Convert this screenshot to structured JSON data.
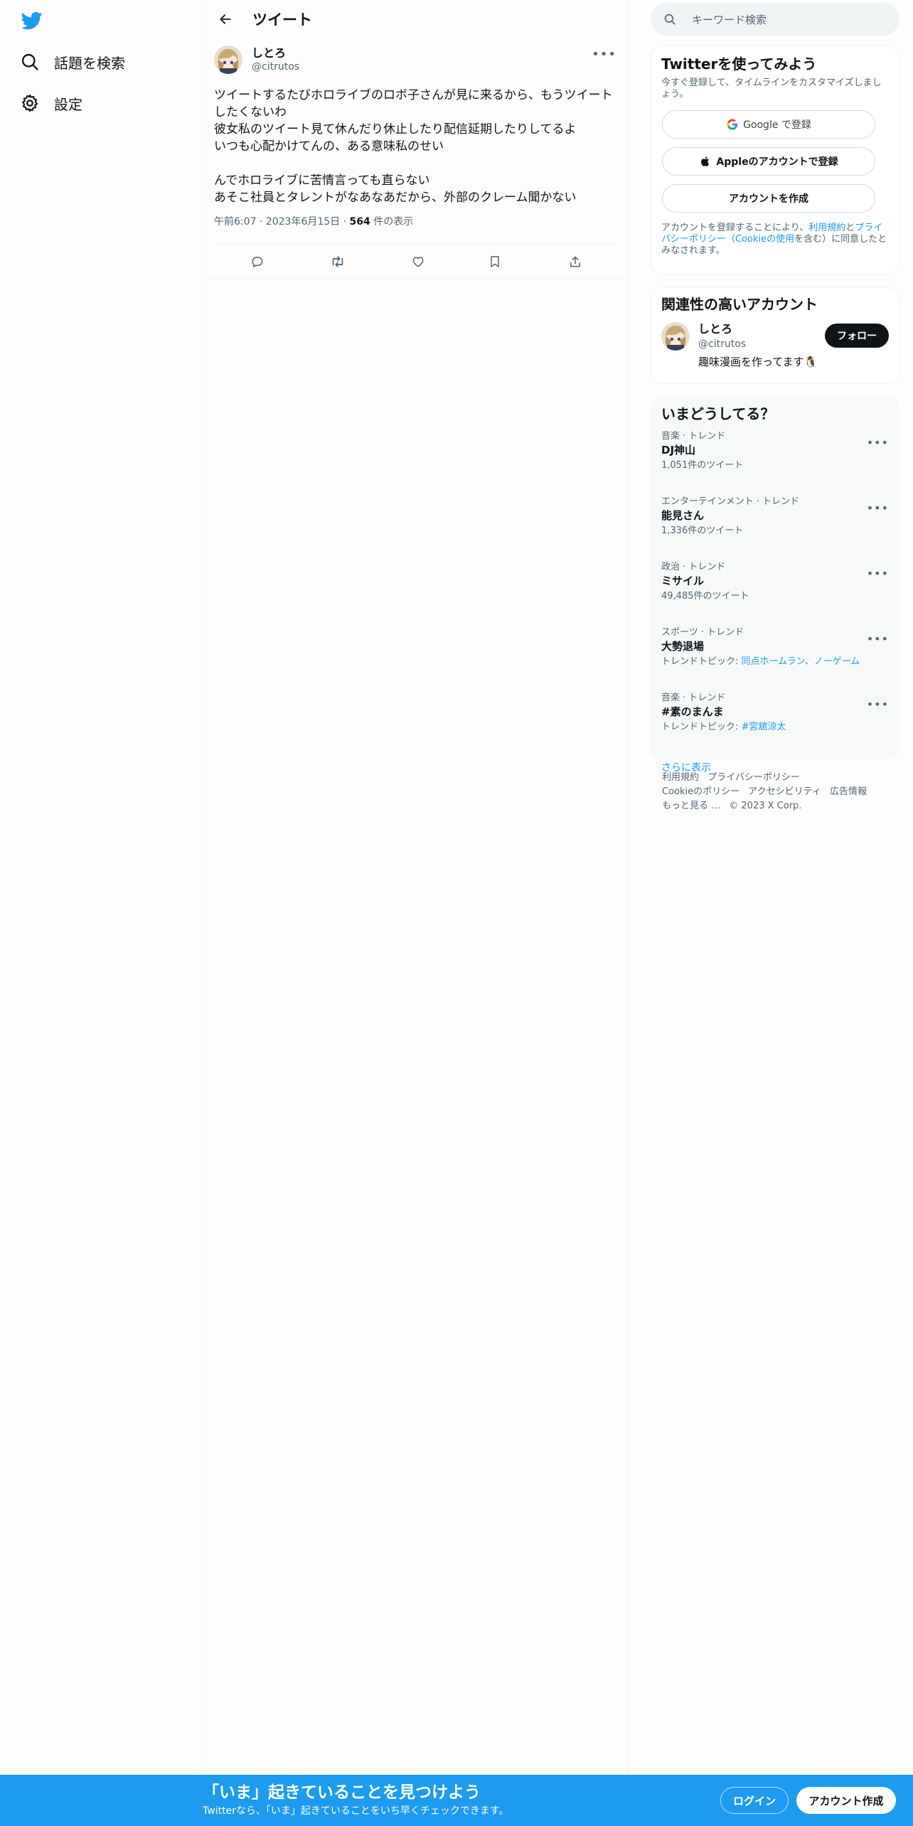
{
  "nav": {
    "logo_icon": "twitter-bird-icon",
    "items": [
      {
        "label": "話題を検索",
        "icon": "search-icon"
      },
      {
        "label": "設定",
        "icon": "gear-icon"
      }
    ]
  },
  "main": {
    "title": "ツイート",
    "tweet": {
      "author_name": "しとろ",
      "author_handle": "@citrutos",
      "text": "ツイートするたびホロライブのロボ子さんが見に来るから、もうツイートしたくないわ\n彼女私のツイート見て休んだり休止したり配信延期したりしてるよ\nいつも心配かけてんの、ある意味私のせい\n\nんでホロライブに苦情言っても直らない\nあそこ社員とタレントがなあなあだから、外部のクレーム聞かない",
      "time": "午前6:07",
      "date": "2023年6月15日",
      "views_count": "564",
      "views_label": "件の表示",
      "sep": "·"
    }
  },
  "right": {
    "search_placeholder": "キーワード検索",
    "signup": {
      "title": "Twitterを使ってみよう",
      "subtitle": "今すぐ登録して、タイムラインをカスタマイズしましょう。",
      "google_label": "Google で登録",
      "apple_label": "Appleのアカウントで登録",
      "create_label": "アカウントを作成",
      "legal_pre": "アカウントを登録することにより、",
      "legal_terms": "利用規約",
      "legal_and": "と",
      "legal_privacy": "プライバシーポリシー",
      "legal_paren_open": "（",
      "legal_cookie": "Cookieの使用",
      "legal_post": "を含む）に同意したとみなされます。"
    },
    "related": {
      "title": "関連性の高いアカウント",
      "name": "しとろ",
      "handle": "@citrutos",
      "bio": "趣味漫画を作ってます🐧",
      "follow_label": "フォロー"
    },
    "trends": {
      "title": "いまどうしてる？",
      "items": [
        {
          "category": "音楽 · トレンド",
          "name": "DJ神山",
          "count": "1,051件のツイート"
        },
        {
          "category": "エンターテインメント · トレンド",
          "name": "能見さん",
          "count": "1,336件のツイート"
        },
        {
          "category": "政治 · トレンド",
          "name": "ミサイル",
          "count": "49,485件のツイート"
        },
        {
          "category": "スポーツ · トレンド",
          "name": "大勢退場",
          "topic_label": "トレンドトピック: ",
          "topic": "同点ホームラン、ノーゲーム"
        },
        {
          "category": "音楽 · トレンド",
          "name": "#素のまんま",
          "topic_label": "トレンドトピック: ",
          "topic": "#宮舘涼太"
        }
      ],
      "show_more": "さらに表示"
    },
    "footer": {
      "links": [
        "利用規約",
        "プライバシーポリシー",
        "Cookieのポリシー",
        "アクセシビリティ",
        "広告情報",
        "もっと見る …"
      ],
      "copyright": "© 2023 X Corp."
    }
  },
  "bottom_bar": {
    "title": "「いま」起きていることを見つけよう",
    "subtitle": "Twitterなら、「いま」起きていることをいち早くチェックできます。",
    "login_label": "ログイン",
    "signup_label": "アカウント作成"
  },
  "colors": {
    "accent": "#1d9bf0",
    "text": "#0f1419",
    "secondary": "#536471"
  }
}
